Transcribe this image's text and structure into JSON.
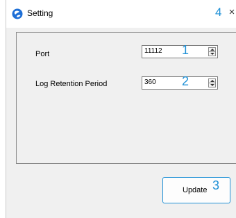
{
  "window": {
    "title": "Setting",
    "close_glyph": "×",
    "icon": "app-globe-icon",
    "accent_color": "#1e90d6"
  },
  "fields": [
    {
      "label": "Port",
      "value": "11112",
      "marker": "1"
    },
    {
      "label": "Log Retention Period",
      "value": "360",
      "marker": "2"
    }
  ],
  "update_button": {
    "label": "Update",
    "marker": "3"
  },
  "close_marker": "4"
}
